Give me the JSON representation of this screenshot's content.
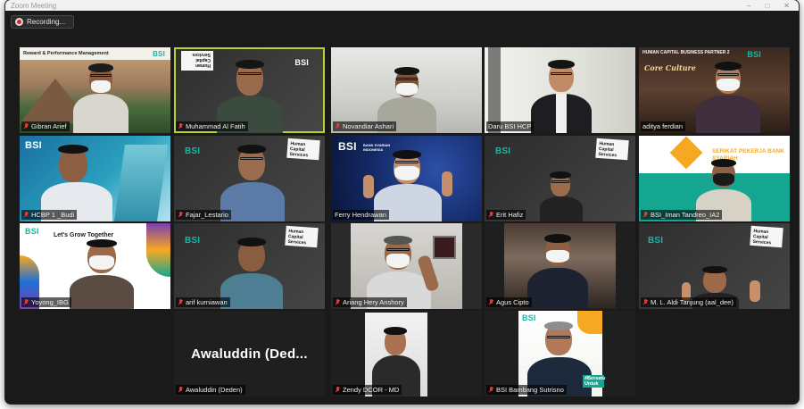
{
  "window": {
    "title": "Zoom Meeting",
    "controls": [
      "–",
      "□",
      "✕"
    ]
  },
  "recording": {
    "label": "Recording..."
  },
  "participants": [
    {
      "name": "Gibran Arief",
      "muted": true,
      "slide_title": "Reward & Performance Management",
      "logo": "BSI"
    },
    {
      "name": "Muhammad Al Fatih",
      "muted": true,
      "active_speaker": true,
      "card_text": "Human Capital Services",
      "logo": "BSI"
    },
    {
      "name": "Novandiar Ashari",
      "muted": true
    },
    {
      "name": "Daru BSI HCP",
      "muted": false
    },
    {
      "name": "aditya ferdian",
      "muted": false,
      "banner": "HUMAN CAPITAL BUSINESS PARTNER 2",
      "script_text": "Core Culture",
      "logo": "BSI"
    },
    {
      "name": "HCBP 1 _Budi",
      "muted": true,
      "logo": "BSI"
    },
    {
      "name": "Fajar_Lestario",
      "muted": true,
      "card_text": "Human Capital Services",
      "logo": "BSI"
    },
    {
      "name": "Ferry Hendrawan",
      "muted": false,
      "logo": "BSI",
      "logo_sub": "BANK SYARIAH INDONESIA"
    },
    {
      "name": "Erit Hafiz",
      "muted": true,
      "card_text": "Human Capital Services",
      "logo": "BSI"
    },
    {
      "name": "BSI_Iman Tandreo_IA2",
      "muted": true,
      "banner": "SERIKAT PEKERJA BANK SYARIAH"
    },
    {
      "name": "Yoyong_IBG",
      "muted": true,
      "slide_title": "Let's Grow Together",
      "logo": "BSI"
    },
    {
      "name": "arif kurniawan",
      "muted": true,
      "card_text": "Human Capital Services",
      "logo": "BSI"
    },
    {
      "name": "Ariang Hery Anshory",
      "muted": true
    },
    {
      "name": "Agus Cipto",
      "muted": true
    },
    {
      "name": "M. L. Aldi Tanjung (aal_dee)",
      "muted": true,
      "card_text": "Human Capital Services",
      "logo": "BSI"
    },
    {
      "name": "Awaluddin (Deden)",
      "muted": true,
      "display_name": "Awaluddin  (Ded..."
    },
    {
      "name": "Zendy DCOR - MD",
      "muted": true
    },
    {
      "name": "BSI Bambang Sutrisno",
      "muted": true,
      "logo": "BSI",
      "badge": "#Bersatu Untuk"
    }
  ],
  "colors": {
    "window_bg": "#1a1a1a",
    "active_border": "#b4d236",
    "muted_icon": "#e53935",
    "bsi_teal": "#1bb5a3",
    "bsi_orange": "#f7a823"
  },
  "icons": {
    "recording": "record-dot-icon",
    "muted": "mic-muted-icon"
  }
}
